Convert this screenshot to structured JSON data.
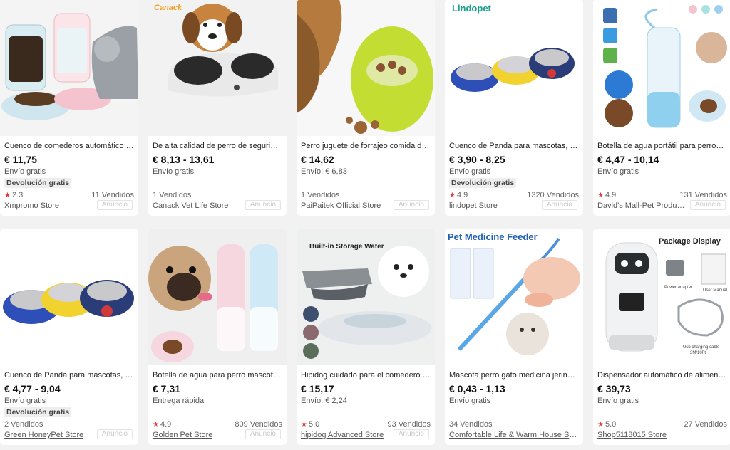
{
  "products": [
    {
      "title": "Cuenco de comederos automático para gatos y perros",
      "price": "€ 11,75",
      "shipping": "Envío gratis",
      "badge": "Devolución gratis",
      "rating": "2.3",
      "sold": "11 Vendidos",
      "store": "Xmpromo Store",
      "ad": "Anuncio",
      "image": "auto-feeder-dispensers-with-cat"
    },
    {
      "title": "De alta calidad de perro de seguridad cuenco doble",
      "price": "€ 8,13 - 13,61",
      "shipping": "Envío gratis",
      "badge": "",
      "rating": "",
      "sold": "1 Vendidos",
      "store": "Canack Vet Life Store",
      "ad": "Anuncio",
      "image": "puppy-double-bowl",
      "brand_text": "Canack"
    },
    {
      "title": "Perro juguete de forrajeo comida dispensador",
      "price": "€ 14,62",
      "shipping": "Envío: € 6,83",
      "badge": "",
      "rating": "",
      "sold": "1 Vendidos",
      "store": "PaiPaitek Official Store",
      "ad": "Anuncio",
      "image": "dog-with-treat-egg"
    },
    {
      "title": "Cuenco de Panda para mascotas, comedero de acero",
      "price": "€ 3,90 - 8,25",
      "shipping": "Envío gratis",
      "badge": "Devolución gratis",
      "rating": "4.9",
      "sold": "1320 Vendidos",
      "store": "lindopet Store",
      "ad": "Anuncio",
      "image": "cartoon-steel-bowls",
      "brand_text": "Lindopet"
    },
    {
      "title": "Botella de agua portátil para perros y gatos",
      "price": "€ 4,47 - 10,14",
      "shipping": "Envío gratis",
      "badge": "",
      "rating": "4.9",
      "sold": "131 Vendidos",
      "store": "David's Mall-Pet Products Store",
      "ad": "Anuncio",
      "image": "portable-water-bottle"
    },
    {
      "title": "Cuenco de Panda para mascotas, comedero de acero",
      "price": "€ 4,77 - 9,04",
      "shipping": "Envío gratis",
      "badge": "Devolución gratis",
      "rating": "",
      "sold": "2 Vendidos",
      "store": "Green HoneyPet Store",
      "ad": "Anuncio",
      "image": "cartoon-steel-bowls-large"
    },
    {
      "title": "Botella de agua para perro mascota portátil",
      "price": "€ 7,31",
      "shipping": "Entrega rápida",
      "badge": "",
      "rating": "4.9",
      "sold": "809 Vendidos",
      "store": "Golden Pet Store",
      "ad": "Anuncio",
      "image": "pug-with-bottles"
    },
    {
      "title": "Hipidog cuidado para el comedero de agua",
      "price": "€ 15,17",
      "shipping": "Envío: € 2,24",
      "badge": "",
      "rating": "5.0",
      "sold": "93 Vendidos",
      "store": "hipidog Advanced Store",
      "ad": "Anuncio",
      "image": "storage-water-bowl",
      "img_caption": "Built-in Storage Water"
    },
    {
      "title": "Mascota perro gato medicina jeringa alimentador",
      "price": "€ 0,43 - 1,13",
      "shipping": "Envío gratis",
      "badge": "",
      "rating": "",
      "sold": "34 Vendidos",
      "store": "Comfortable Life & Warm House Store",
      "ad": "",
      "image": "medicine-feeder-syringe",
      "img_caption": "Pet Medicine Feeder"
    },
    {
      "title": "Dispensador automático de alimentos para mascotas",
      "price": "€ 39,73",
      "shipping": "Envío gratis",
      "badge": "",
      "rating": "5.0",
      "sold": "27 Vendidos",
      "store": "Shop5118015 Store",
      "ad": "",
      "image": "robot-auto-feeder",
      "img_caption": "Package Display",
      "img_labels": [
        "Power adapter",
        "User Manual",
        "Usb charging cable",
        "3M/10Ft"
      ]
    }
  ],
  "colors": {
    "star": "#e23b3b",
    "background": "#f2f2f2",
    "card": "#ffffff",
    "price": "#111111"
  }
}
